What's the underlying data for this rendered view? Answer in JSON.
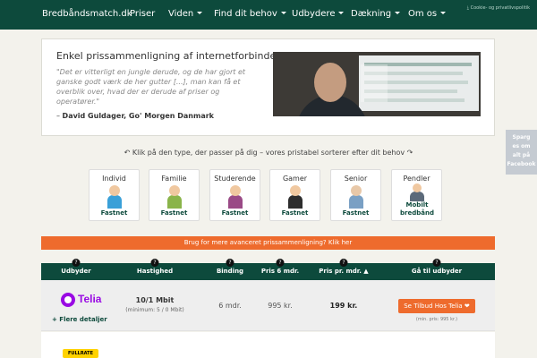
{
  "nav": {
    "brand": "Bredbåndsmatch.dk",
    "items": [
      {
        "label": "Priser",
        "dropdown": false
      },
      {
        "label": "Viden",
        "dropdown": true
      },
      {
        "label": "Find dit behov",
        "dropdown": true
      },
      {
        "label": "Udbydere",
        "dropdown": true
      },
      {
        "label": "Dækning",
        "dropdown": true
      },
      {
        "label": "Om os",
        "dropdown": true
      }
    ],
    "cookie_link": "Cookie- og privatlivspolitik"
  },
  "testimonial": {
    "heading": "Enkel prissammenligning af internetforbindelser",
    "quote": "\"Det er vitterligt en jungle derude, og de har gjort et ganske godt værk de her gutter [...], man kan få et overblik over, hvad der er derude af priser og operatører.\"",
    "author_prefix": "– ",
    "author_name": "David Guldager, Go' Morgen Danmark"
  },
  "instruction": "↶ Klik på den type, der passer på dig – vores pristabel sorterer efter dit behov ↷",
  "side_tab": [
    "Sparg",
    "es om",
    "alt på",
    "Facebook"
  ],
  "personas": [
    {
      "label": "Individ",
      "tag": "Fastnet",
      "color": "#3aa0d8"
    },
    {
      "label": "Familie",
      "tag": "Fastnet",
      "color": "#8ab44a"
    },
    {
      "label": "Studerende",
      "tag": "Fastnet",
      "color": "#9a4a86"
    },
    {
      "label": "Gamer",
      "tag": "Fastnet",
      "color": "#2d2d2d"
    },
    {
      "label": "Senior",
      "tag": "Fastnet",
      "color": "#7aa0c4"
    },
    {
      "label": "Pendler",
      "tag": "Mobilt bredbånd",
      "color": "#5c6a7a"
    }
  ],
  "banner": "Brug for mere avanceret prissammenligning? Klik her",
  "table": {
    "headers": [
      "Udbyder",
      "Hastighed",
      "Binding",
      "Pris 6 mdr.",
      "Pris pr. mdr. ▲",
      "Gå til udbyder"
    ],
    "rows": [
      {
        "provider": "Telia",
        "details": "+ Flere detaljer",
        "speed": "10/1 Mbit",
        "speed_min": "(minimum: 5 / 0 Mbit)",
        "binding": "6 mdr.",
        "price_6": "995 kr.",
        "price_month": "199 kr.",
        "cta": "Se Tilbud Hos Telia ❤",
        "cta_note": "(min. pris: 995 kr.)"
      },
      {
        "provider": "FULLRATE"
      }
    ]
  },
  "colors": {
    "primary": "#0d4a3c",
    "accent": "#ee6b2d",
    "telia": "#990ae3",
    "fullrate": "#ffd200"
  }
}
